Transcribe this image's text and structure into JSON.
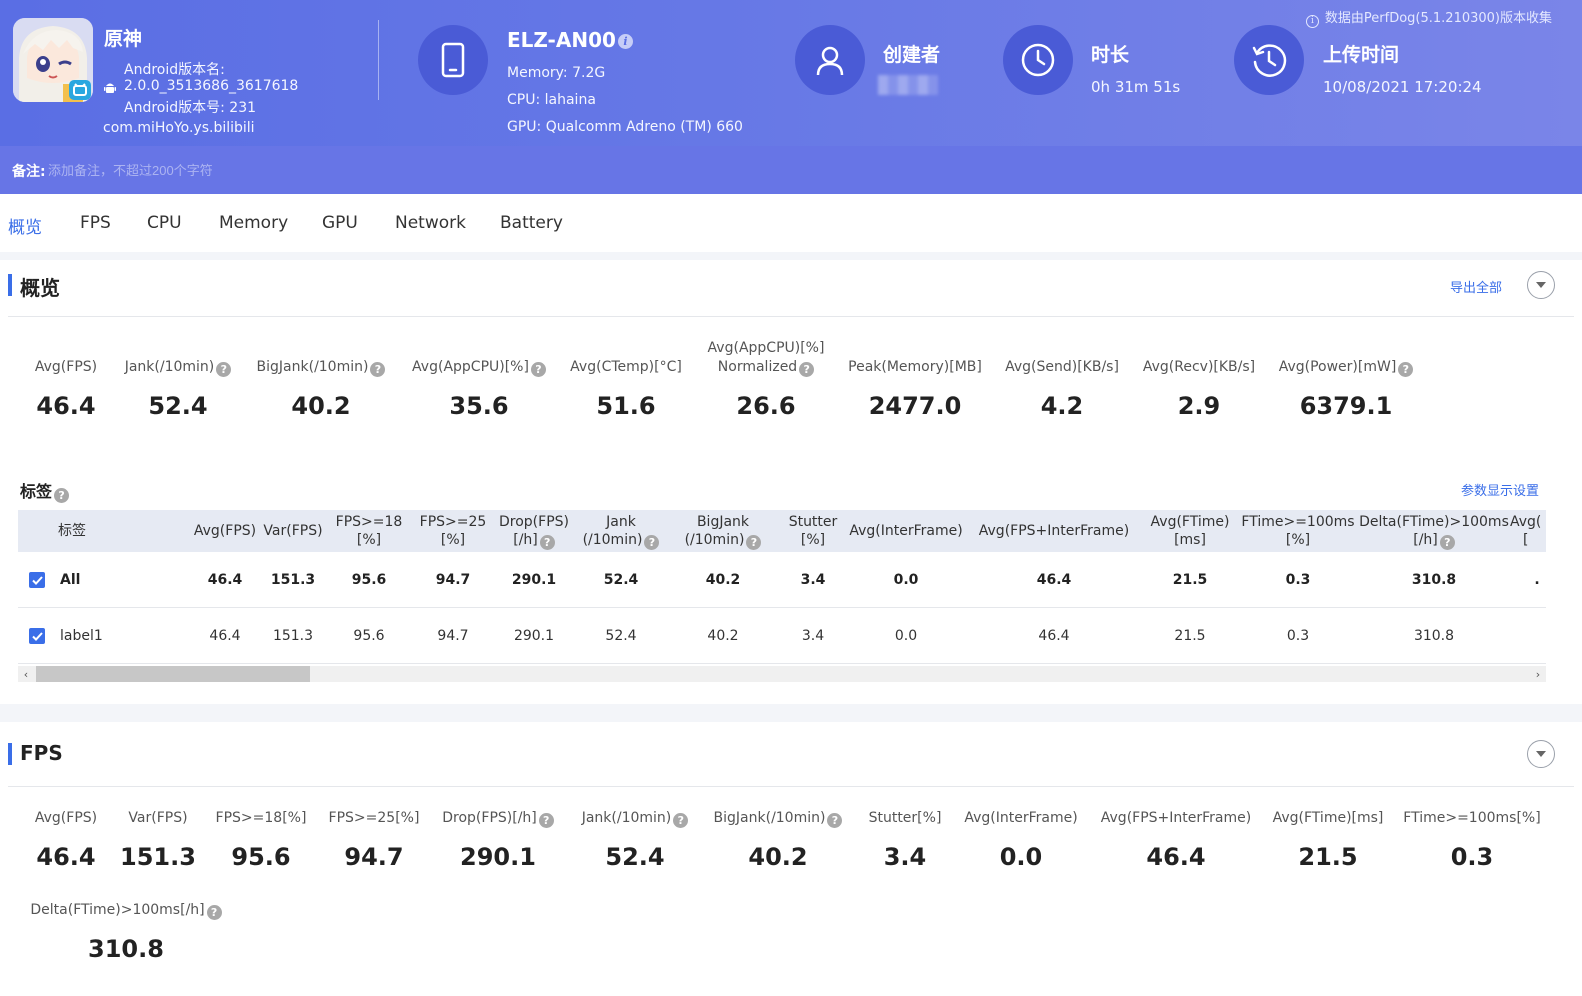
{
  "notice": "数据由PerfDog(5.1.210300)版本收集",
  "app": {
    "name": "原神",
    "version_name_label": "Android版本名:",
    "version_name": "2.0.0_3513686_3617618",
    "version_code": "Android版本号: 231",
    "package": "com.miHoYo.ys.bilibili"
  },
  "device": {
    "name": "ELZ-AN00",
    "memory": "Memory: 7.2G",
    "cpu": "CPU: lahaina",
    "gpu": "GPU: Qualcomm Adreno (TM) 660"
  },
  "creator": {
    "title": "创建者"
  },
  "duration": {
    "title": "时长",
    "value": "0h 31m 51s"
  },
  "upload": {
    "title": "上传时间",
    "value": "10/08/2021 17:20:24"
  },
  "remark": {
    "label": "备注:",
    "placeholder": "添加备注，不超过200个字符"
  },
  "tabs": [
    "概览",
    "FPS",
    "CPU",
    "Memory",
    "GPU",
    "Network",
    "Battery"
  ],
  "overview": {
    "title": "概览",
    "export_label": "导出全部",
    "stats": [
      {
        "label": "Avg(FPS)",
        "value": "46.4"
      },
      {
        "label": "Jank(/10min)",
        "value": "52.4"
      },
      {
        "label": "BigJank(/10min)",
        "value": "40.2"
      },
      {
        "label": "Avg(AppCPU)[%]",
        "value": "35.6"
      },
      {
        "label": "Avg(CTemp)[°C]",
        "value": "51.6"
      },
      {
        "label": "Avg(AppCPU)[%]",
        "label2": "Normalized",
        "value": "26.6"
      },
      {
        "label": "Peak(Memory)[MB]",
        "value": "2477.0"
      },
      {
        "label": "Avg(Send)[KB/s]",
        "value": "4.2"
      },
      {
        "label": "Avg(Recv)[KB/s]",
        "value": "2.9"
      },
      {
        "label": "Avg(Power)[mW]",
        "value": "6379.1"
      }
    ]
  },
  "labels": {
    "title": "标签",
    "settings_label": "参数显示设置",
    "headers": [
      {
        "l1": "标签"
      },
      {
        "l1": "Avg(FPS)"
      },
      {
        "l1": "Var(FPS)"
      },
      {
        "l1": "FPS>=18",
        "l2": "[%]"
      },
      {
        "l1": "FPS>=25",
        "l2": "[%]"
      },
      {
        "l1": "Drop(FPS)",
        "l2": "[/h]"
      },
      {
        "l1": "Jank",
        "l2": "(/10min)"
      },
      {
        "l1": "BigJank",
        "l2": "(/10min)"
      },
      {
        "l1": "Stutter",
        "l2": "[%]"
      },
      {
        "l1": "Avg(InterFrame)"
      },
      {
        "l1": "Avg(FPS+InterFrame)"
      },
      {
        "l1": "Avg(FTime)",
        "l2": "[ms]"
      },
      {
        "l1": "FTime>=100ms",
        "l2": "[%]"
      },
      {
        "l1": "Delta(FTime)>100ms",
        "l2": "[/h]"
      },
      {
        "l1": "Avg(",
        "l2": "["
      }
    ],
    "rows": [
      {
        "cells": [
          "All",
          "46.4",
          "151.3",
          "95.6",
          "94.7",
          "290.1",
          "52.4",
          "40.2",
          "3.4",
          "0.0",
          "46.4",
          "21.5",
          "0.3",
          "310.8",
          "."
        ]
      },
      {
        "cells": [
          "label1",
          "46.4",
          "151.3",
          "95.6",
          "94.7",
          "290.1",
          "52.4",
          "40.2",
          "3.4",
          "0.0",
          "46.4",
          "21.5",
          "0.3",
          "310.8",
          ""
        ]
      }
    ]
  },
  "fps": {
    "title": "FPS",
    "stats": [
      {
        "label": "Avg(FPS)",
        "value": "46.4"
      },
      {
        "label": "Var(FPS)",
        "value": "151.3"
      },
      {
        "label": "FPS>=18[%]",
        "value": "95.6"
      },
      {
        "label": "FPS>=25[%]",
        "value": "94.7"
      },
      {
        "label": "Drop(FPS)[/h]",
        "value": "290.1"
      },
      {
        "label": "Jank(/10min)",
        "value": "52.4"
      },
      {
        "label": "BigJank(/10min)",
        "value": "40.2"
      },
      {
        "label": "Stutter[%]",
        "value": "3.4"
      },
      {
        "label": "Avg(InterFrame)",
        "value": "0.0"
      },
      {
        "label": "Avg(FPS+InterFrame)",
        "value": "46.4"
      },
      {
        "label": "Avg(FTime)[ms]",
        "value": "21.5"
      },
      {
        "label": "FTime>=100ms[%]",
        "value": "0.3"
      },
      {
        "label": "Delta(FTime)>100ms[/h]",
        "value": "310.8"
      }
    ]
  },
  "colors": {
    "header": "#5a6ee4",
    "accent": "#3a6ee8",
    "icon_circle": "#4a5bd6"
  },
  "icons": [
    "info-icon",
    "android-icon",
    "phone-icon",
    "user-icon",
    "clock-icon",
    "history-icon",
    "question-icon",
    "chevron-down-icon",
    "checkbox-icon"
  ]
}
